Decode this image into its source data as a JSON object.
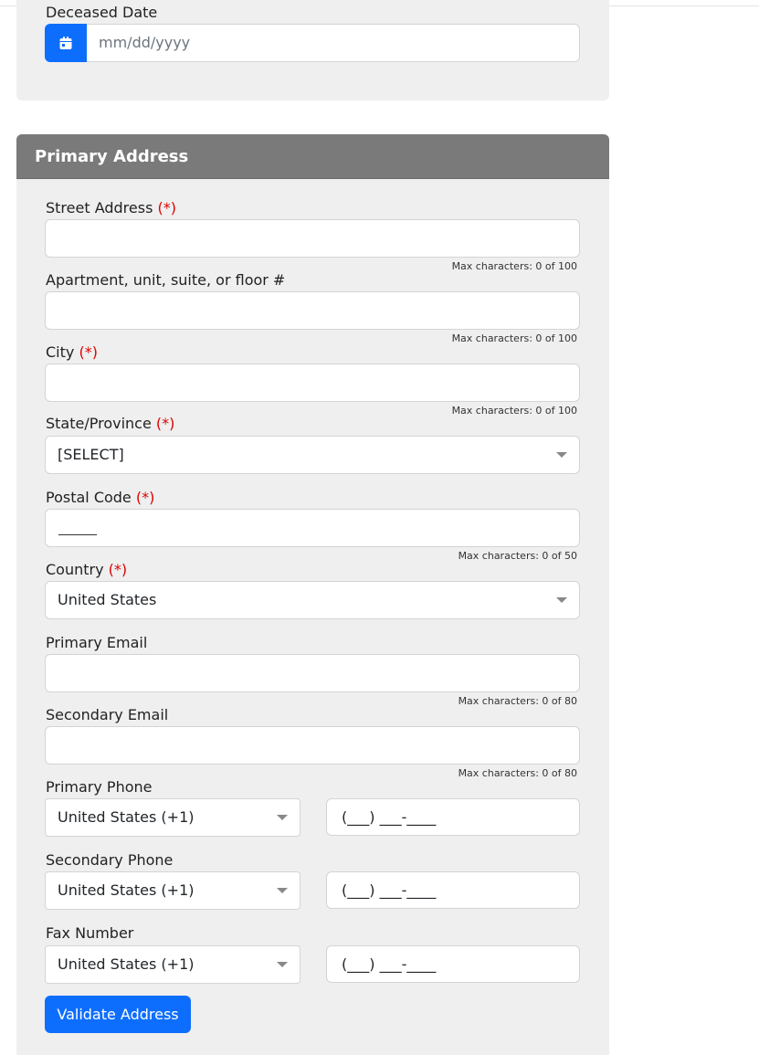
{
  "deceased_date": {
    "label": "Deceased Date",
    "placeholder": "mm/dd/yyyy",
    "icon": "calendar-icon"
  },
  "primary_address": {
    "title": "Primary Address",
    "required_marker": "(*)",
    "street": {
      "label": "Street Address",
      "value": "",
      "hint": "Max characters: 0 of 100"
    },
    "apartment": {
      "label": "Apartment, unit, suite, or floor #",
      "value": "",
      "hint": "Max characters: 0 of 100"
    },
    "city": {
      "label": "City",
      "value": "",
      "hint": "Max characters: 0 of 100"
    },
    "state": {
      "label": "State/Province",
      "selected": "[SELECT]"
    },
    "postal": {
      "label": "Postal Code",
      "value": "_____",
      "hint": "Max characters: 0 of 50"
    },
    "country": {
      "label": "Country",
      "selected": "United States"
    },
    "primary_email": {
      "label": "Primary Email",
      "value": "",
      "hint": "Max characters: 0 of 80"
    },
    "secondary_email": {
      "label": "Secondary Email",
      "value": "",
      "hint": "Max characters: 0 of 80"
    },
    "primary_phone": {
      "label": "Primary Phone",
      "country": "United States (+1)",
      "number": "(___) ___-____"
    },
    "secondary_phone": {
      "label": "Secondary Phone",
      "country": "United States (+1)",
      "number": "(___) ___-____"
    },
    "fax": {
      "label": "Fax Number",
      "country": "United States (+1)",
      "number": "(___) ___-____"
    },
    "validate_button": "Validate Address"
  },
  "colors": {
    "accent": "#0d6efd",
    "panel_background": "#efefef",
    "header_background": "#7a7a7a",
    "required": "#e00000"
  }
}
